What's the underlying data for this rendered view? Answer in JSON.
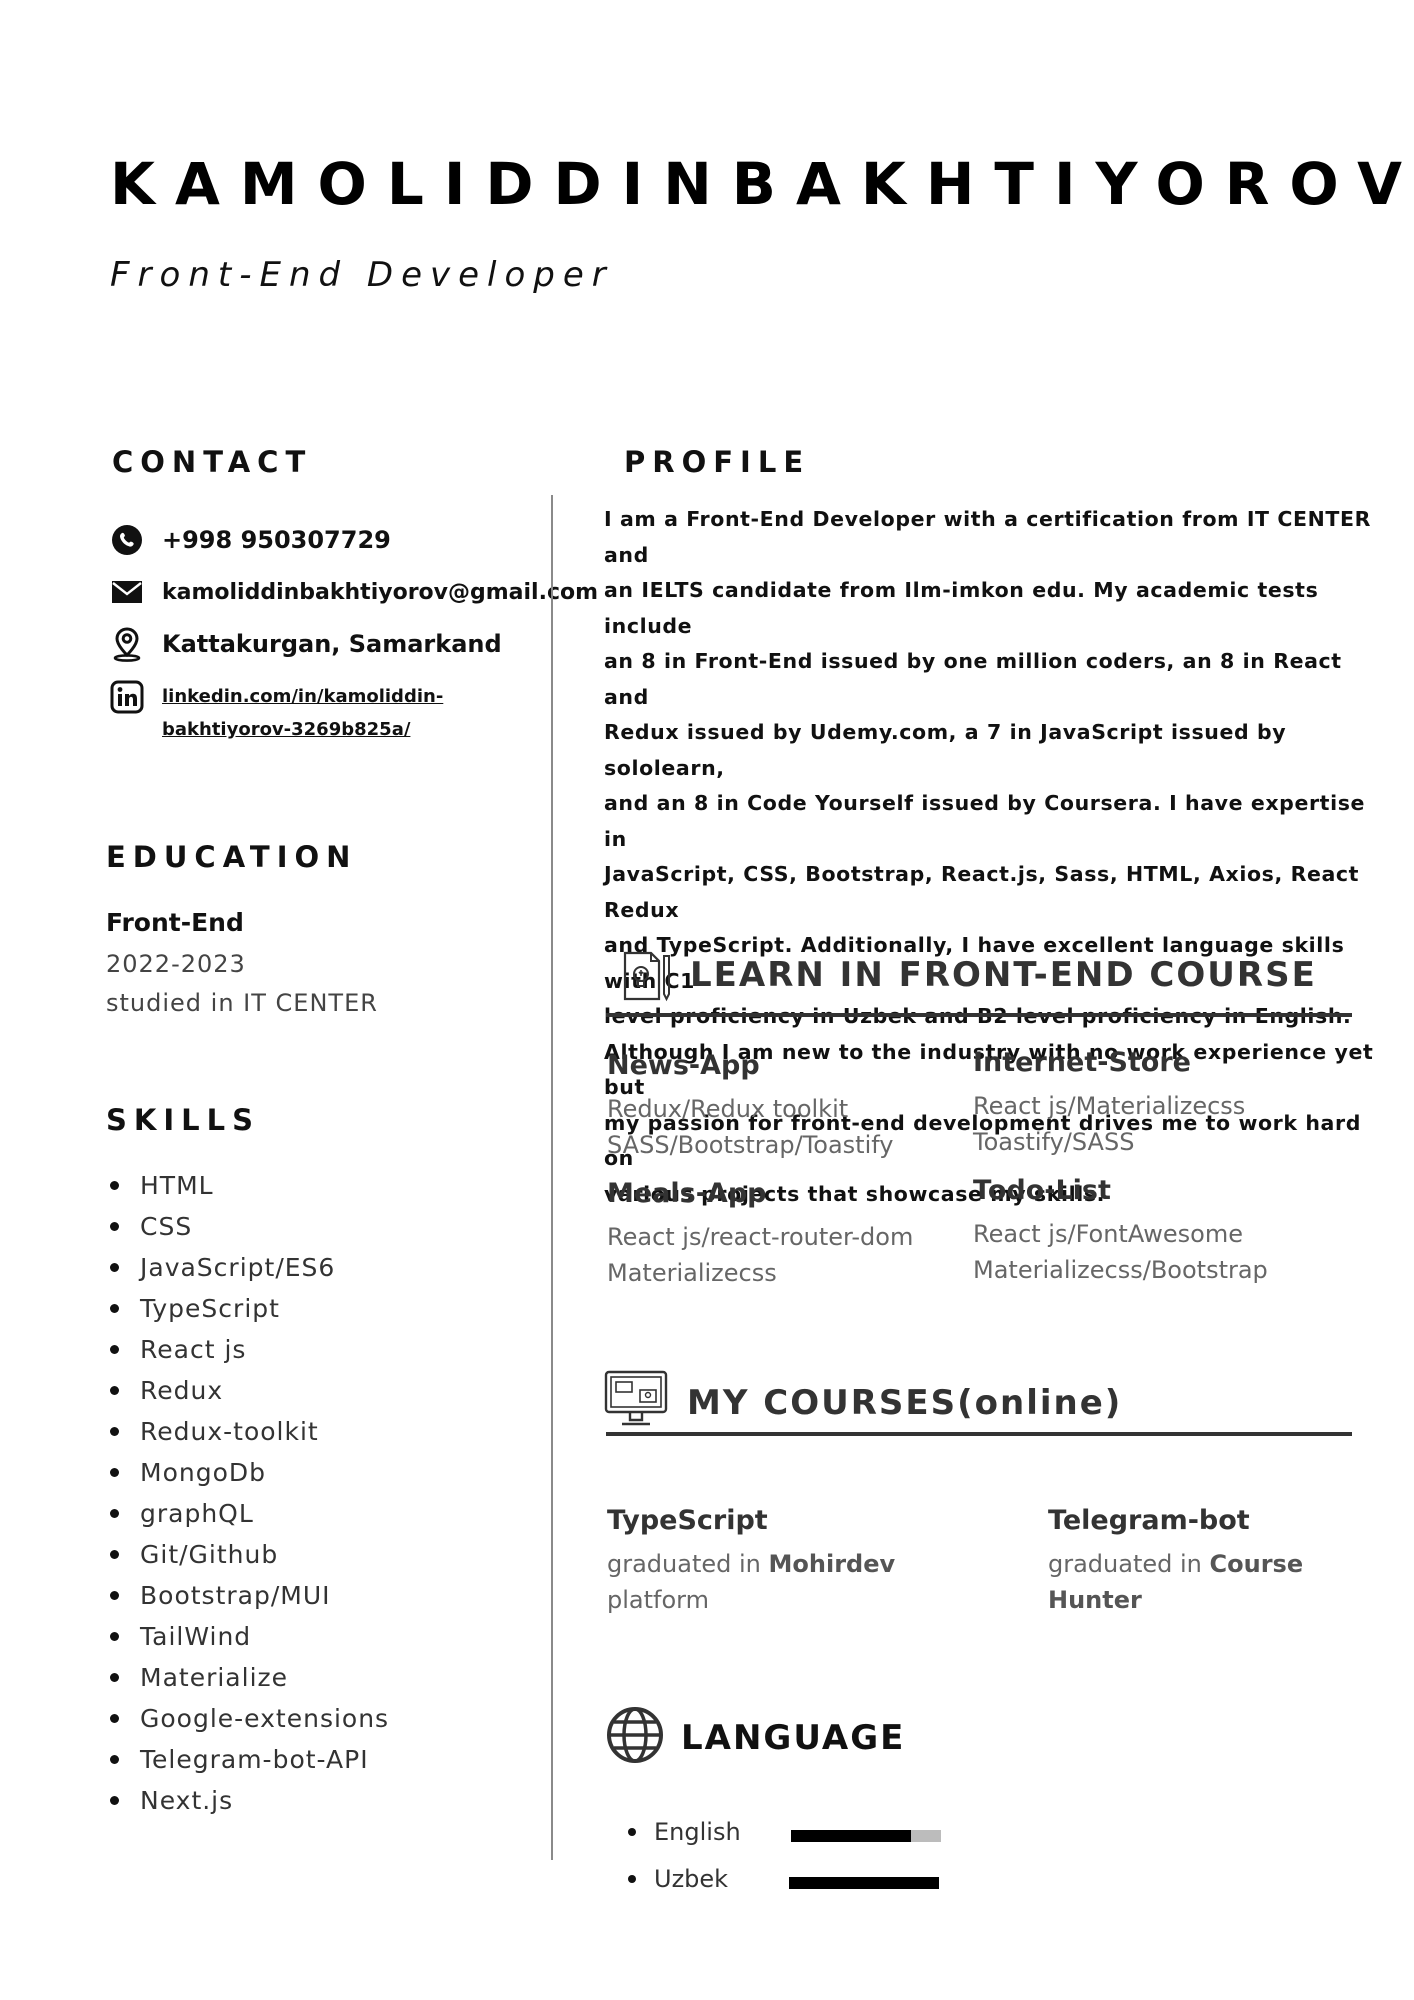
{
  "header": {
    "name": "KAMOLIDDINBAKHTIYOROV",
    "title": "Front-End Developer"
  },
  "contact": {
    "heading": "CONTACT",
    "phone": "+998 950307729",
    "email": "kamoliddinbakhtiyorov@gmail.com",
    "location": "Kattakurgan, Samarkand",
    "linkedin_line1": "linkedin.com/in/kamoliddin-",
    "linkedin_line2": "bakhtiyorov-3269b825a/",
    "icons": [
      "phone-icon",
      "mail-icon",
      "location-pin-icon",
      "linkedin-icon"
    ]
  },
  "education": {
    "heading": "EDUCATION",
    "title": "Front-End",
    "years": "2022-2023",
    "place": "studied in IT CENTER"
  },
  "skills": {
    "heading": "SKILLS",
    "items": [
      "HTML",
      "CSS",
      "JavaScript/ES6",
      "TypeScript",
      "React js",
      "Redux",
      "Redux-toolkit",
      "MongoDb",
      "graphQL",
      "Git/Github",
      "Bootstrap/MUI",
      "TailWind",
      "Materialize",
      "Google-extensions",
      "Telegram-bot-API",
      "Next.js"
    ]
  },
  "profile": {
    "heading": "PROFILE",
    "lines": [
      "I am a Front-End Developer with a certification from IT CENTER and",
      "an IELTS candidate from Ilm-imkon edu. My academic tests include",
      "an 8 in Front-End issued by one million coders, an 8 in React and",
      "Redux issued by Udemy.com, a 7 in JavaScript issued by sololearn,",
      "and an 8 in Code Yourself issued by Coursera. I have expertise in",
      "JavaScript, CSS, Bootstrap, React.js, Sass, HTML, Axios, React Redux",
      "and TypeScript. Additionally, I have excellent language skills with C1",
      "level proficiency in Uzbek and B2 level proficiency in English.",
      "Although I am new to the industry with no work experience yet but",
      "my passion for front-end development drives me to work hard on",
      "various projects that showcase my skills."
    ]
  },
  "learn": {
    "heading": "LEARN IN FRONT-END COURSE",
    "projects": [
      {
        "name": "News-App",
        "line1": "Redux/Redux toolkit",
        "line2": "SASS/Bootstrap/Toastify"
      },
      {
        "name": "Internet-Store",
        "line1": "React js/Materializecss",
        "line2": "Toastify/SASS"
      },
      {
        "name": "Meals-App",
        "line1": "React js/react-router-dom",
        "line2": "Materializecss"
      },
      {
        "name": "Todo-List",
        "line1": "React js/FontAwesome",
        "line2": "Materializecss/Bootstrap"
      }
    ]
  },
  "courses": {
    "heading": "MY COURSES(online)",
    "items": [
      {
        "name": "TypeScript",
        "prefix": "graduated in ",
        "org": "Mohirdev",
        "suffix": "platform"
      },
      {
        "name": "Telegram-bot",
        "prefix": "graduated in ",
        "org": "Course",
        "suffix": "Hunter"
      }
    ]
  },
  "language": {
    "heading": "LANGUAGE",
    "items": [
      {
        "name": "English",
        "level": 0.8
      },
      {
        "name": "Uzbek",
        "level": 1.0
      }
    ]
  }
}
